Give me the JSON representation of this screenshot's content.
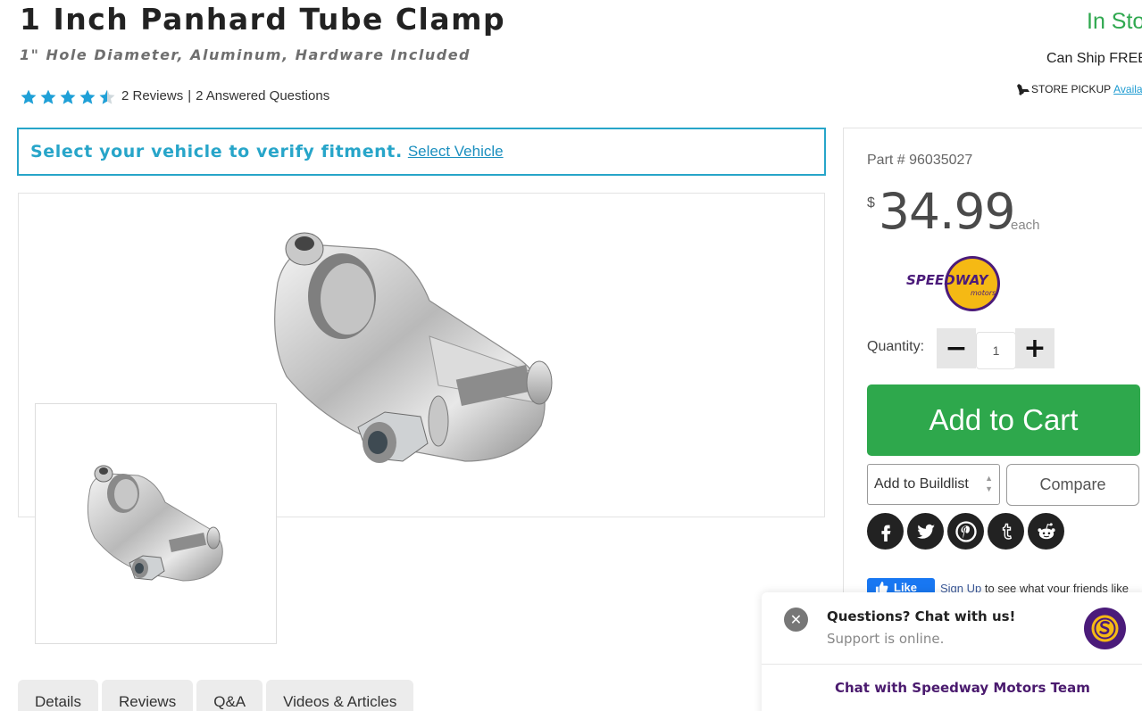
{
  "product": {
    "title": "1 Inch Panhard Tube Clamp",
    "subtitle": "1\" Hole Diameter, Aluminum, Hardware Included",
    "rating": 4.5,
    "reviews_label": "2 Reviews",
    "separator": "|",
    "questions_label": "2 Answered Questions"
  },
  "availability": {
    "stock_label": "In Sto",
    "ship_label": "Can Ship FREE",
    "pickup_label": "STORE PICKUP",
    "pickup_link": "Availat"
  },
  "fitment": {
    "message": "Select your vehicle to verify fitment.",
    "link": "Select Vehicle"
  },
  "buy_box": {
    "part_number": "Part # 96035027",
    "currency_symbol": "$",
    "price": "34.99",
    "price_unit": "each",
    "brand": "SPEEDWAY",
    "brand_sub": "motors",
    "quantity_label": "Quantity:",
    "quantity_minus": "−",
    "quantity_plus": "+",
    "quantity_value": "1",
    "add_to_cart": "Add to Cart",
    "buildlist_label": "Add to Buildlist",
    "compare_label": "Compare",
    "social": [
      "facebook-icon",
      "twitter-icon",
      "pinterest-icon",
      "tumblr-icon",
      "reddit-icon"
    ],
    "fb_like": "Like",
    "fb_signup": "Sign Up",
    "fb_text": "to see what your friends like"
  },
  "tabs": [
    "Details",
    "Reviews",
    "Q&A",
    "Videos & Articles"
  ],
  "chat": {
    "close": "✕",
    "title": "Questions? Chat with us!",
    "status": "Support is online.",
    "cta": "Chat with Speedway Motors Team"
  },
  "colors": {
    "star": "#1fa0d7",
    "in_stock": "#2fa84f",
    "fitment": "#27a5c9",
    "add_to_cart": "#2ea84c",
    "chat_cta": "#4a1a6e",
    "brand_yellow": "#f5b914",
    "brand_purple": "#4b1b7a"
  }
}
